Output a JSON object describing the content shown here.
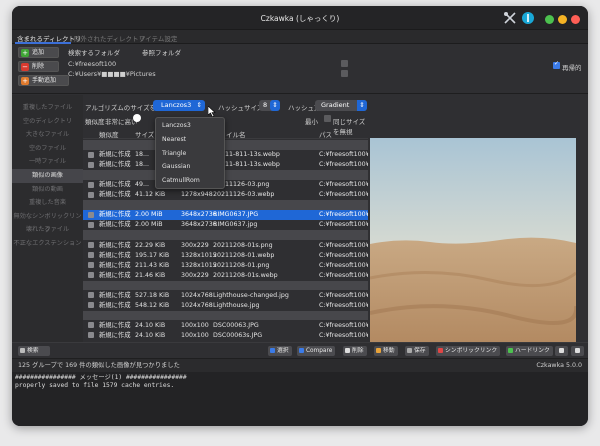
{
  "window": {
    "title": "Czkawka (しゃっくり)"
  },
  "tabs": [
    "含まれるディレクトリ",
    "除外されたディレクトリ",
    "アイテム設定"
  ],
  "dirs": {
    "add": "追加",
    "remove": "削除",
    "manual_add": "手動追加",
    "header_search": "検索するフォルダ",
    "header_ref": "参照フォルダ",
    "paths": [
      "C:¥freesoft100",
      "C:¥Users¥■■■■¥Pictures"
    ],
    "recursive": "再帰的"
  },
  "sidebar": [
    "重複したファイル",
    "空のディレクトリ",
    "大きなファイル",
    "空のファイル",
    "一時ファイル",
    "類似の画像",
    "類似の動画",
    "重複した音楽",
    "無効なシンボリックリンク",
    "壊れたファイル",
    "不正なエクステンション"
  ],
  "sidebar_selected": 5,
  "toolbar": {
    "resize_label": "アルゴリズムのサイズを変更",
    "resize_value": "Lanczos3",
    "hash_size_label": "ハッシュサイズ",
    "hash_size_value": "8",
    "hash_method_label": "ハッシュ方式",
    "hash_method_value": "Gradient",
    "similarity_label": "類似度",
    "similarity_value": "非常に高い",
    "min_label": "最小",
    "same_size_label": "同じサイズを無視"
  },
  "dropdown": [
    "Lanczos3",
    "Nearest",
    "Triangle",
    "Gaussian",
    "CatmullRom"
  ],
  "table": {
    "headers": [
      "類似度",
      "サイズ",
      "寸法",
      "ファイル名",
      "パス"
    ]
  },
  "rows": [
    {
      "type": "group"
    },
    {
      "type": "file",
      "sim": "新規に作成",
      "size": "18...",
      "dim": "",
      "name": "20211-811-13s.webp",
      "path": "C:¥freesoft100¥Ph"
    },
    {
      "type": "file",
      "sim": "新規に作成",
      "size": "18...",
      "dim": "",
      "name": "20211-811-13s.webp",
      "path": "C:¥freesoft100¥Ph"
    },
    {
      "type": "group"
    },
    {
      "type": "file",
      "sim": "新規に作成",
      "size": "49...",
      "dim": "",
      "name": "20211126-03.png",
      "path": "C:¥freesoft100¥Ph"
    },
    {
      "type": "file",
      "sim": "新規に作成",
      "size": "41.12 KiB",
      "dim": "1278x948",
      "name": "20211126-03.webp",
      "path": "C:¥freesoft100¥Ph"
    },
    {
      "type": "group"
    },
    {
      "type": "sel",
      "sim": "新規に作成",
      "size": "2.00 MiB",
      "dim": "3648x2736",
      "name": "RIMG0637.JPG",
      "path": "C:¥freesoft100¥Ph"
    },
    {
      "type": "file",
      "sim": "新規に作成",
      "size": "2.00 MiB",
      "dim": "3648x2736",
      "name": "RIMG0637.jpg",
      "path": "C:¥freesoft100¥Ph"
    },
    {
      "type": "group"
    },
    {
      "type": "file",
      "sim": "新規に作成",
      "size": "22.29 KiB",
      "dim": "300x229",
      "name": "20211208-01s.png",
      "path": "C:¥freesoft100¥Ph"
    },
    {
      "type": "file",
      "sim": "新規に作成",
      "size": "195.17 KiB",
      "dim": "1328x1015",
      "name": "20211208-01.webp",
      "path": "C:¥freesoft100¥Ph"
    },
    {
      "type": "file",
      "sim": "新規に作成",
      "size": "211.43 KiB",
      "dim": "1328x1015",
      "name": "20211208-01.png",
      "path": "C:¥freesoft100¥Ph"
    },
    {
      "type": "file",
      "sim": "新規に作成",
      "size": "21.46 KiB",
      "dim": "300x229",
      "name": "20211208-01s.webp",
      "path": "C:¥freesoft100¥Ph"
    },
    {
      "type": "group"
    },
    {
      "type": "file",
      "sim": "新規に作成",
      "size": "527.18 KiB",
      "dim": "1024x768",
      "name": "Lighthouse-changed.jpg",
      "path": "C:¥freesoft100¥Ph"
    },
    {
      "type": "file",
      "sim": "新規に作成",
      "size": "548.12 KiB",
      "dim": "1024x768",
      "name": "Lighthouse.jpg",
      "path": "C:¥freesoft100¥Ph"
    },
    {
      "type": "group"
    },
    {
      "type": "file",
      "sim": "新規に作成",
      "size": "24.10 KiB",
      "dim": "100x100",
      "name": "DSC00063.JPG",
      "path": "C:¥freesoft100¥Ca"
    },
    {
      "type": "file",
      "sim": "新規に作成",
      "size": "24.10 KiB",
      "dim": "100x100",
      "name": "DSC00063s.JPG",
      "path": "C:¥freesoft100¥Ca"
    }
  ],
  "bottom": {
    "search": "検索",
    "buttons": [
      "選択",
      "Compare",
      "削除",
      "移動",
      "保存",
      "シンボリックリンク",
      "ハードリンク"
    ]
  },
  "status": {
    "text": "125 グループで 169 件の類似した画像が見つかりました",
    "version": "Czkawka 5.0.0"
  },
  "log": [
    "################ メッセージ(1) ################",
    "properly saved to file 1579 cache entries."
  ],
  "colors": {
    "accent": "#3b6fd8",
    "selection": "#1f67d6"
  }
}
